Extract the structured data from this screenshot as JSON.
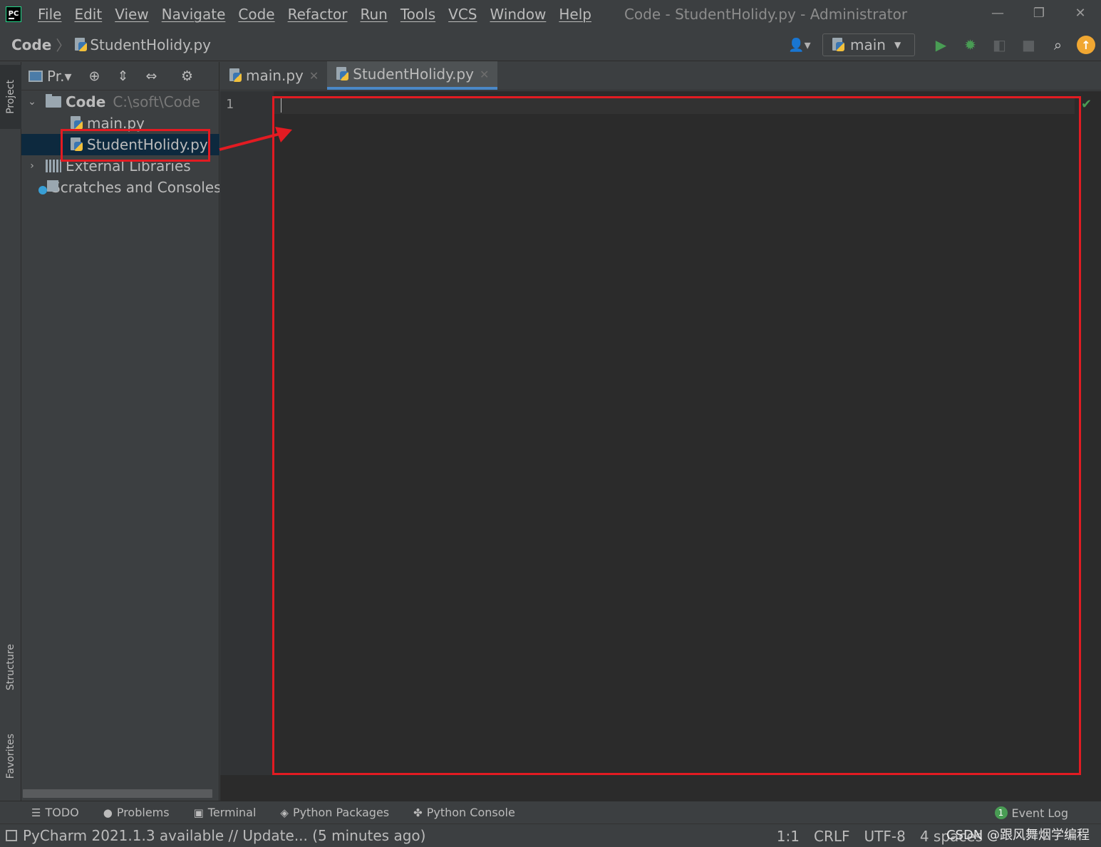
{
  "titlebar": {
    "logo": "PC",
    "menu": [
      "File",
      "Edit",
      "View",
      "Navigate",
      "Code",
      "Refactor",
      "Run",
      "Tools",
      "VCS",
      "Window",
      "Help"
    ],
    "window_title": "Code - StudentHolidy.py - Administrator"
  },
  "navbar": {
    "root": "Code",
    "file": "StudentHolidy.py",
    "run_config": "main"
  },
  "project_panel": {
    "title": "Pr.▾",
    "tree": {
      "root_name": "Code",
      "root_path": "C:\\soft\\Code",
      "files": [
        "main.py",
        "StudentHolidy.py"
      ],
      "external": "External Libraries",
      "scratches": "Scratches and Consoles"
    }
  },
  "side_tabs": {
    "project": "Project",
    "structure": "Structure",
    "favorites": "Favorites"
  },
  "editor": {
    "tabs": [
      "main.py",
      "StudentHolidy.py"
    ],
    "active_tab": "StudentHolidy.py",
    "line_numbers": [
      "1"
    ]
  },
  "tool_stripe": {
    "todo": "TODO",
    "problems": "Problems",
    "terminal": "Terminal",
    "packages": "Python Packages",
    "console": "Python Console",
    "event_log": "Event Log",
    "event_count": "1"
  },
  "status_bar": {
    "message": "PyCharm 2021.1.3 available // Update... (5 minutes ago)",
    "position": "1:1",
    "line_sep": "CRLF",
    "encoding": "UTF-8",
    "indent": "4 spaces",
    "watermark": "CSDN @跟风舞烟学编程"
  },
  "colors": {
    "accent": "#4a88c7",
    "annotation_red": "#e21b22",
    "run_green": "#499c54",
    "update_orange": "#f0a732"
  }
}
